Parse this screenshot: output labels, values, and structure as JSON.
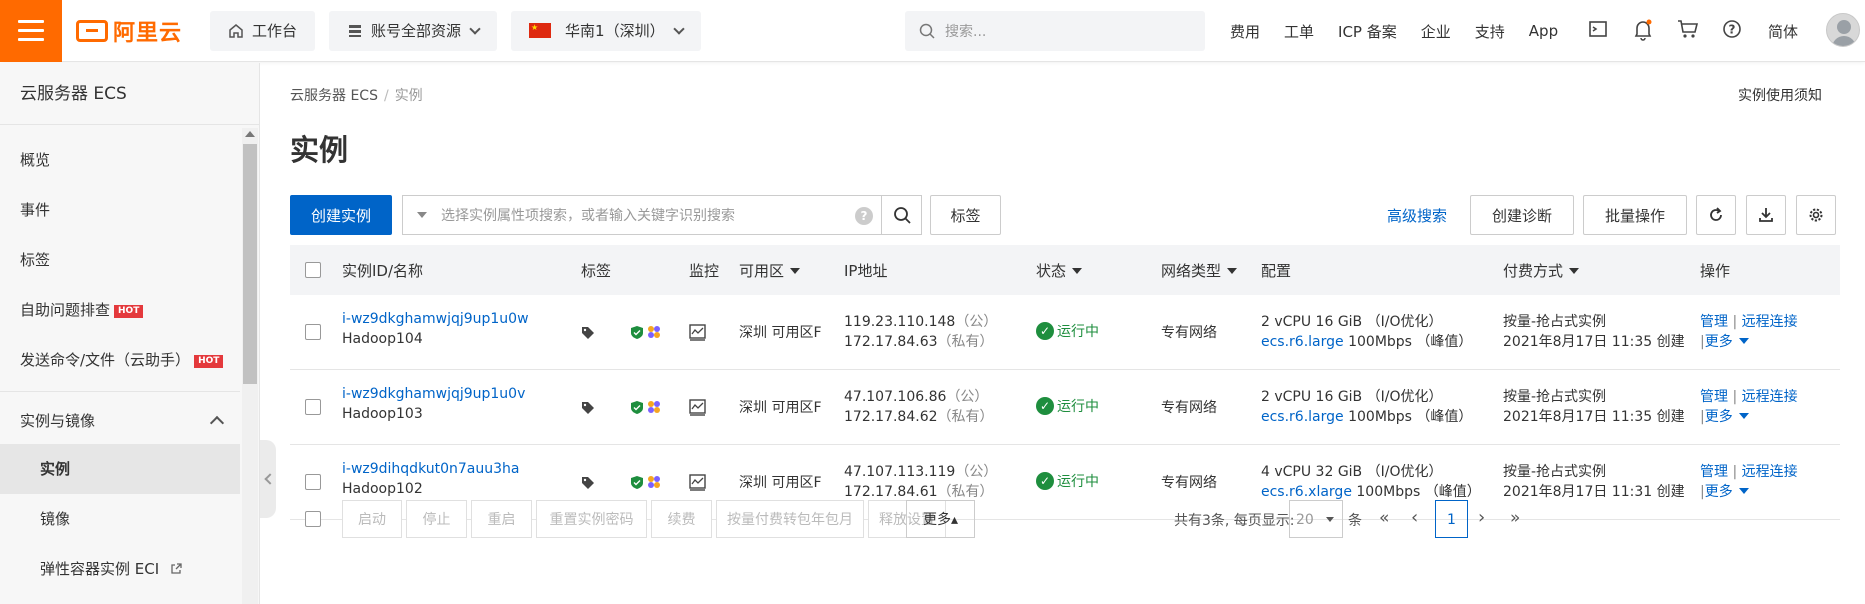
{
  "topbar": {
    "logo_text": "阿里云",
    "workbench": "工作台",
    "resources": "账号全部资源",
    "region": "华南1（深圳）",
    "search_placeholder": "搜索...",
    "nav": [
      "费用",
      "工单",
      "ICP 备案",
      "企业",
      "支持",
      "App"
    ],
    "lang": "简体"
  },
  "sidebar": {
    "title": "云服务器 ECS",
    "items": [
      "概览",
      "事件",
      "标签",
      "自助问题排查",
      "发送命令/文件（云助手）"
    ],
    "hot": "HOT",
    "section": "实例与镜像",
    "subitems": [
      "实例",
      "镜像",
      "弹性容器实例 ECI"
    ]
  },
  "breadcrumb": {
    "root": "云服务器 ECS",
    "sep": "/",
    "current": "实例"
  },
  "notice": "实例使用须知",
  "page_title": "实例",
  "toolbar": {
    "create": "创建实例",
    "search_placeholder": "选择实例属性项搜索，或者输入关键字识别搜索",
    "tag": "标签",
    "advanced": "高级搜索",
    "diagnose": "创建诊断",
    "batch": "批量操作"
  },
  "table": {
    "headers": {
      "id": "实例ID/名称",
      "tag": "标签",
      "monitor": "监控",
      "zone": "可用区",
      "ip": "IP地址",
      "status": "状态",
      "net": "网络类型",
      "config": "配置",
      "pay": "付费方式",
      "ops": "操作"
    },
    "rows": [
      {
        "id": "i-wz9dkghamwjqj9up1u0w",
        "name": "Hadoop104",
        "zone": "深圳 可用区F",
        "ip_pub": "119.23.110.148",
        "ip_pub_tag": "（公）",
        "ip_pri": "172.17.84.63",
        "ip_pri_tag": "（私有）",
        "status": "运行中",
        "net": "专有网络",
        "cfg1": "2 vCPU 16 GiB （I/O优化）",
        "cfg_type": "ecs.r6.large",
        "cfg_bw": "100Mbps （峰值）",
        "pay1": "按量-抢占式实例",
        "pay2": "2021年8月17日 11:35 创建"
      },
      {
        "id": "i-wz9dkghamwjqj9up1u0v",
        "name": "Hadoop103",
        "zone": "深圳 可用区F",
        "ip_pub": "47.107.106.86",
        "ip_pub_tag": "（公）",
        "ip_pri": "172.17.84.62",
        "ip_pri_tag": "（私有）",
        "status": "运行中",
        "net": "专有网络",
        "cfg1": "2 vCPU 16 GiB （I/O优化）",
        "cfg_type": "ecs.r6.large",
        "cfg_bw": "100Mbps （峰值）",
        "pay1": "按量-抢占式实例",
        "pay2": "2021年8月17日 11:35 创建"
      },
      {
        "id": "i-wz9dihqdkut0n7auu3ha",
        "name": "Hadoop102",
        "zone": "深圳 可用区F",
        "ip_pub": "47.107.113.119",
        "ip_pub_tag": "（公）",
        "ip_pri": "172.17.84.61",
        "ip_pri_tag": "（私有）",
        "status": "运行中",
        "net": "专有网络",
        "cfg1": "4 vCPU 32 GiB （I/O优化）",
        "cfg_type": "ecs.r6.xlarge",
        "cfg_bw": "100Mbps （峰值）",
        "pay1": "按量-抢占式实例",
        "pay2": "2021年8月17日 11:31 创建"
      }
    ],
    "ops": {
      "manage": "管理",
      "remote": "远程连接",
      "more": "更多",
      "sep": "|"
    }
  },
  "footer": {
    "buttons": [
      "启动",
      "停止",
      "重启",
      "重置实例密码",
      "续费",
      "按量付费转包年包月",
      "释放设置"
    ],
    "more": "更多▴",
    "summary": "共有3条, 每页显示:",
    "page_size": "20",
    "unit": "条",
    "first": "«",
    "prev": "‹",
    "current_page": "1",
    "next": "›",
    "last": "»"
  }
}
